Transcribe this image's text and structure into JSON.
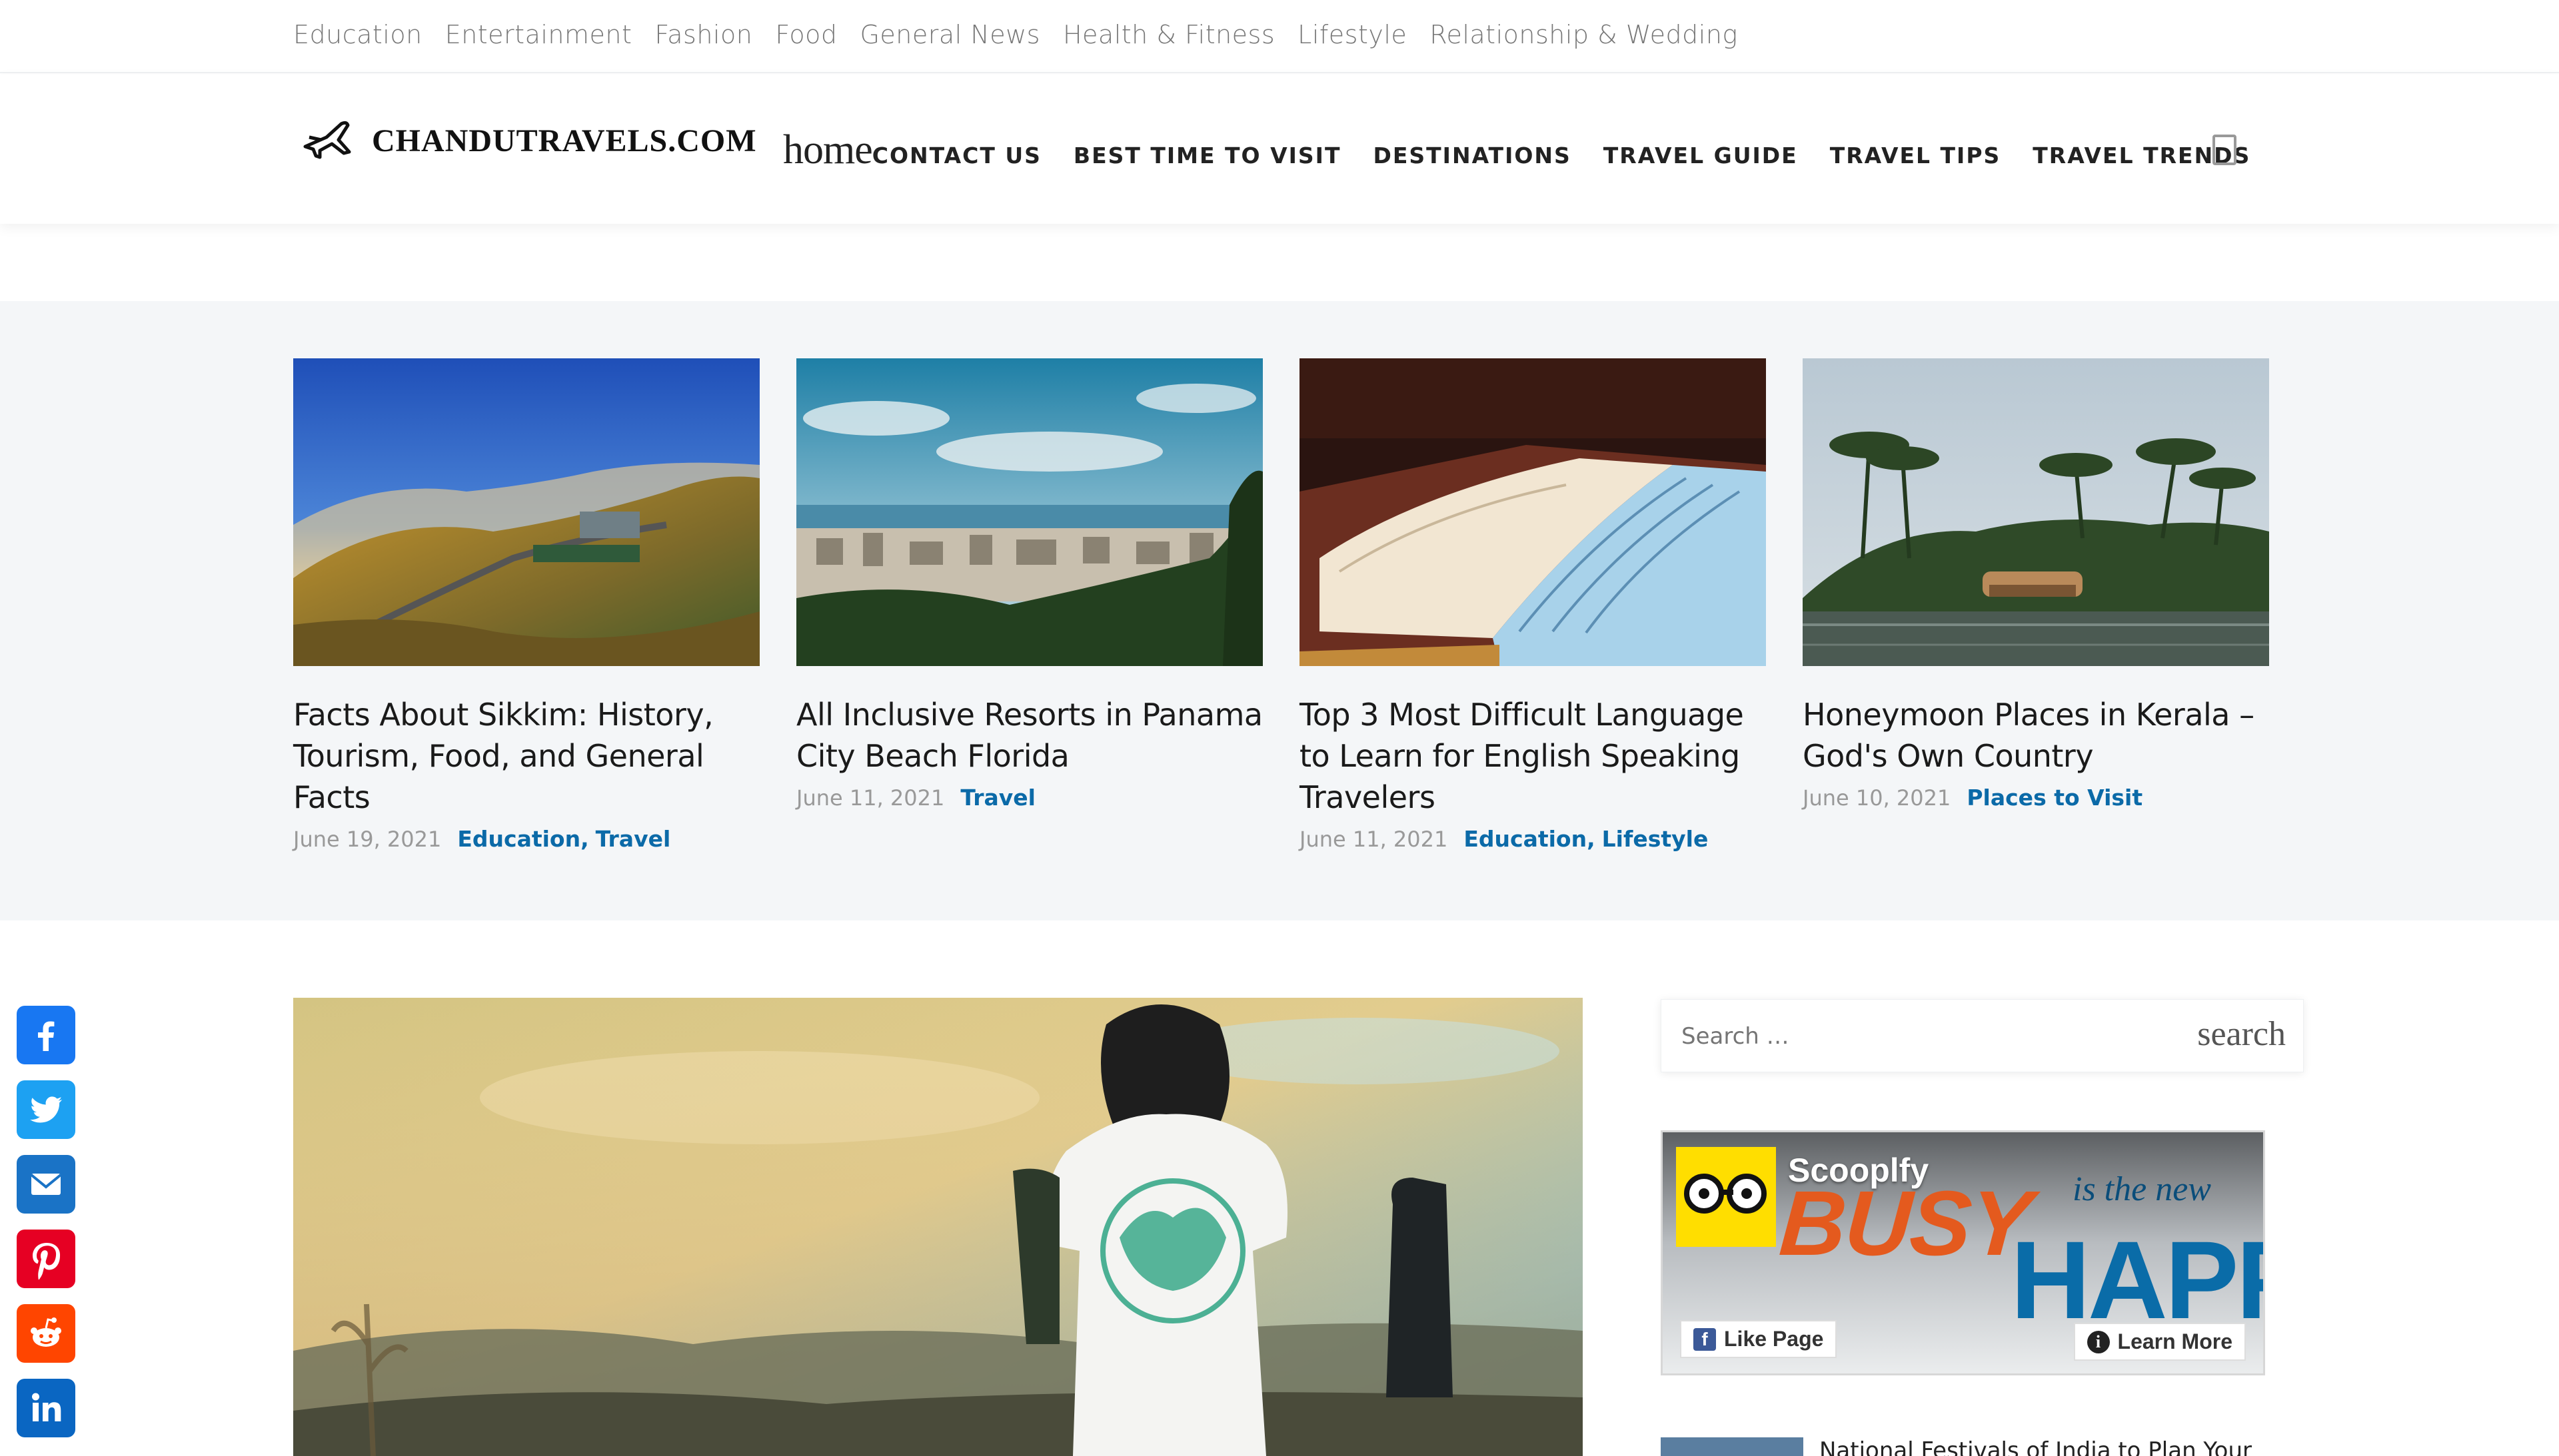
{
  "top_bar": {
    "categories": [
      "Education",
      "Entertainment",
      "Fashion",
      "Food",
      "General News",
      "Health & Fitness",
      "Lifestyle",
      "Relationship & Wedding"
    ]
  },
  "header": {
    "site_name": "CHANDUTRAVELS.COM",
    "nav": {
      "home": "home",
      "items": [
        "CONTACT US",
        "BEST TIME TO VISIT",
        "DESTINATIONS",
        "TRAVEL GUIDE",
        "TRAVEL TIPS",
        "TRAVEL TRENDS"
      ]
    }
  },
  "featured": [
    {
      "title": "Facts About Sikkim: History, Tourism, Food, and General Facts",
      "date": "June 19, 2021",
      "categories": [
        "Education,",
        "Travel"
      ]
    },
    {
      "title": "All Inclusive Resorts in Panama City Beach Florida",
      "date": "June 11, 2021",
      "categories": [
        "Travel"
      ]
    },
    {
      "title": "Top 3 Most Difficult Language to Learn for English Speaking Travelers",
      "date": "June 11, 2021",
      "categories": [
        "Education,",
        "Lifestyle"
      ]
    },
    {
      "title": "Honeymoon Places in Kerala – God's Own Country",
      "date": "June 10, 2021",
      "categories": [
        "Places to Visit"
      ]
    }
  ],
  "sidebar": {
    "search": {
      "placeholder": "Search …",
      "button": "search"
    },
    "ad": {
      "brand": "Scooplfy",
      "busy": "BUSY",
      "is_the_new": "is the new",
      "happy": "HAPPY",
      "like_page": "Like Page",
      "learn_more": "Learn More"
    },
    "next_post": "National Festivals of India to Plan Your"
  },
  "social": [
    "facebook",
    "twitter",
    "email",
    "pinterest",
    "reddit",
    "linkedin"
  ],
  "colors": {
    "accent": "#0b6aa8",
    "strip_bg": "#f4f6f8",
    "facebook": "#1877f2",
    "twitter": "#1da1f2",
    "email": "#1a73c6",
    "pinterest": "#e60023",
    "reddit": "#ff4500",
    "linkedin": "#0a66c2"
  }
}
